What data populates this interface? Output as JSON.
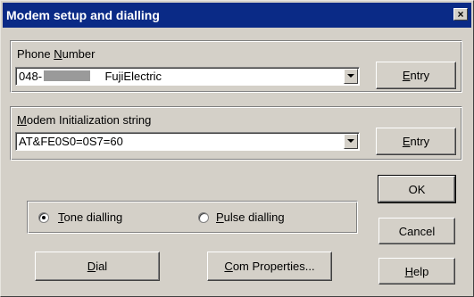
{
  "window": {
    "title": "Modem setup and dialling",
    "close_glyph": "×"
  },
  "phone": {
    "label_pre": "Phone ",
    "label_key": "N",
    "label_post": "umber",
    "value_prefix": "048-",
    "value_suffix": "FujiElectric",
    "entry_key": "E",
    "entry_rest": "ntry"
  },
  "modem": {
    "label_key": "M",
    "label_rest": "odem Initialization string",
    "value": "AT&FE0S0=0S7=60",
    "entry_key": "E",
    "entry_rest": "ntry"
  },
  "buttons": {
    "ok": "OK",
    "cancel": "Cancel",
    "help_key": "H",
    "help_rest": "elp",
    "dial_key": "D",
    "dial_rest": "ial",
    "com_key": "C",
    "com_rest": "om Properties..."
  },
  "dial_mode": {
    "tone_key": "T",
    "tone_rest": "one dialling",
    "pulse_key": "P",
    "pulse_rest": "ulse dialling",
    "selected": "tone"
  }
}
